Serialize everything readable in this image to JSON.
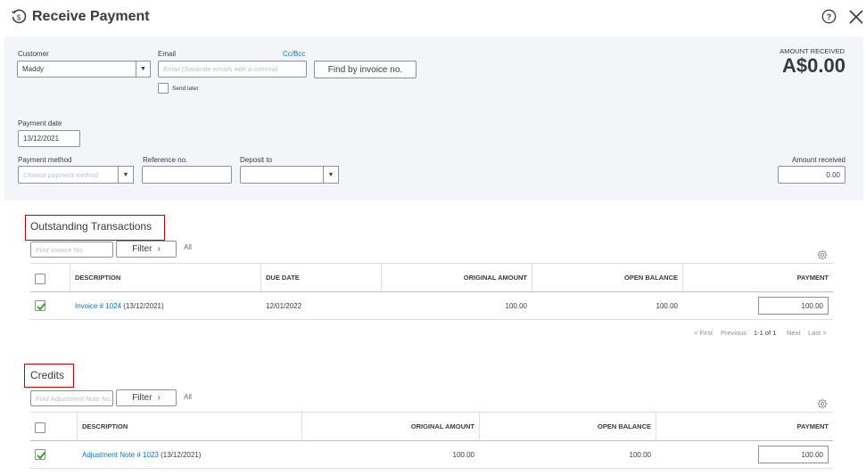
{
  "header": {
    "title": "Receive Payment"
  },
  "form": {
    "customer_label": "Customer",
    "customer_value": "Maddy",
    "email_label": "Email",
    "ccbcc_label": "Cc/Bcc",
    "email_placeholder": "Email (Separate emails with a comma)",
    "send_later_label": "Send later",
    "find_invoice_label": "Find by invoice no.",
    "amount_received_header": "AMOUNT RECEIVED",
    "amount_received_big": "A$0.00",
    "payment_date_label": "Payment date",
    "payment_date_value": "13/12/2021",
    "payment_method_label": "Payment method",
    "payment_method_placeholder": "Choose payment method",
    "reference_label": "Reference no.",
    "deposit_label": "Deposit to",
    "amount_received_label": "Amount received",
    "amount_received_value": "0.00"
  },
  "outstanding": {
    "title": "Outstanding Transactions",
    "search_placeholder": "Find Invoice No.",
    "filter_label": "Filter",
    "all_label": "All",
    "columns": [
      "DESCRIPTION",
      "DUE DATE",
      "ORIGINAL AMOUNT",
      "OPEN BALANCE",
      "PAYMENT"
    ],
    "rows": [
      {
        "link": "Invoice # 1024",
        "date": "(13/12/2021)",
        "due_date": "12/01/2022",
        "original_amount": "100.00",
        "open_balance": "100.00",
        "payment": "100.00"
      }
    ],
    "pager": {
      "first": "< First",
      "previous": "Previous",
      "range": "1-1 of 1",
      "next": "Next",
      "last": "Last >"
    }
  },
  "credits": {
    "title": "Credits",
    "search_placeholder": "Find Adjustment Note No.",
    "filter_label": "Filter",
    "all_label": "All",
    "columns": [
      "DESCRIPTION",
      "ORIGINAL AMOUNT",
      "OPEN BALANCE",
      "PAYMENT"
    ],
    "rows": [
      {
        "link": "Adjustment Note # 1023",
        "date": "(13/12/2021)",
        "original_amount": "100.00",
        "open_balance": "100.00",
        "payment": "100.00"
      }
    ]
  },
  "colors": {
    "link": "#0077c5",
    "highlight_border": "#c00000",
    "checkmark": "#2ca01c"
  }
}
